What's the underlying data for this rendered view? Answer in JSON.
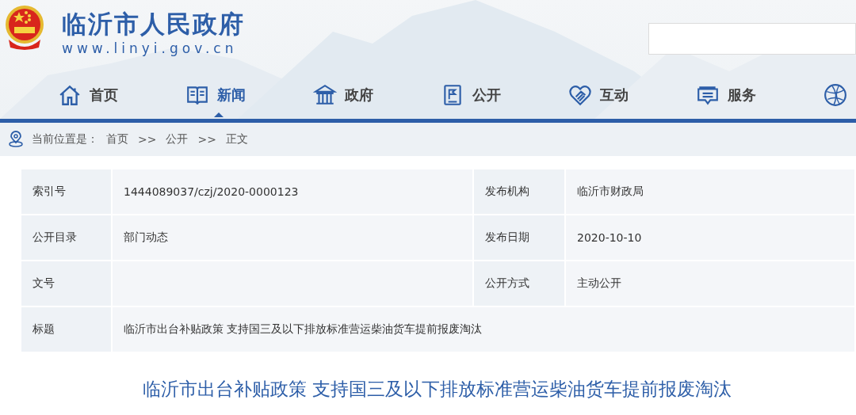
{
  "header": {
    "site_title": "临沂市人民政府",
    "site_url": "www.linyi.gov.cn"
  },
  "nav": [
    {
      "label": "首页",
      "selected": false
    },
    {
      "label": "新闻",
      "selected": true
    },
    {
      "label": "政府",
      "selected": false
    },
    {
      "label": "公开",
      "selected": false
    },
    {
      "label": "互动",
      "selected": false
    },
    {
      "label": "服务",
      "selected": false
    }
  ],
  "breadcrumb": {
    "label": "当前位置是：",
    "items": [
      {
        "text": "首页",
        "kind": "link"
      },
      {
        "text": ">>",
        "kind": "separator"
      },
      {
        "text": "公开",
        "kind": "link"
      },
      {
        "text": ">>",
        "kind": "separator"
      },
      {
        "text": "正文",
        "kind": "current"
      }
    ]
  },
  "info_table": [
    [
      {
        "label": "索引号",
        "value": "1444089037/czj/2020-0000123"
      },
      {
        "label": "发布机构",
        "value": "临沂市财政局"
      }
    ],
    [
      {
        "label": "公开目录",
        "value": "部门动态"
      },
      {
        "label": "发布日期",
        "value": "2020-10-10"
      }
    ],
    [
      {
        "label": "文号"
      },
      {
        "label": "公开方式",
        "value": "主动公开"
      }
    ],
    [
      {
        "label": "标题",
        "value": "临沂市出台补贴政策 支持国三及以下排放标准营运柴油货车提前报废淘汰"
      }
    ]
  ],
  "article": {
    "title": "临沂市出台补贴政策 支持国三及以下排放标准营运柴油货车提前报废淘汰"
  }
}
